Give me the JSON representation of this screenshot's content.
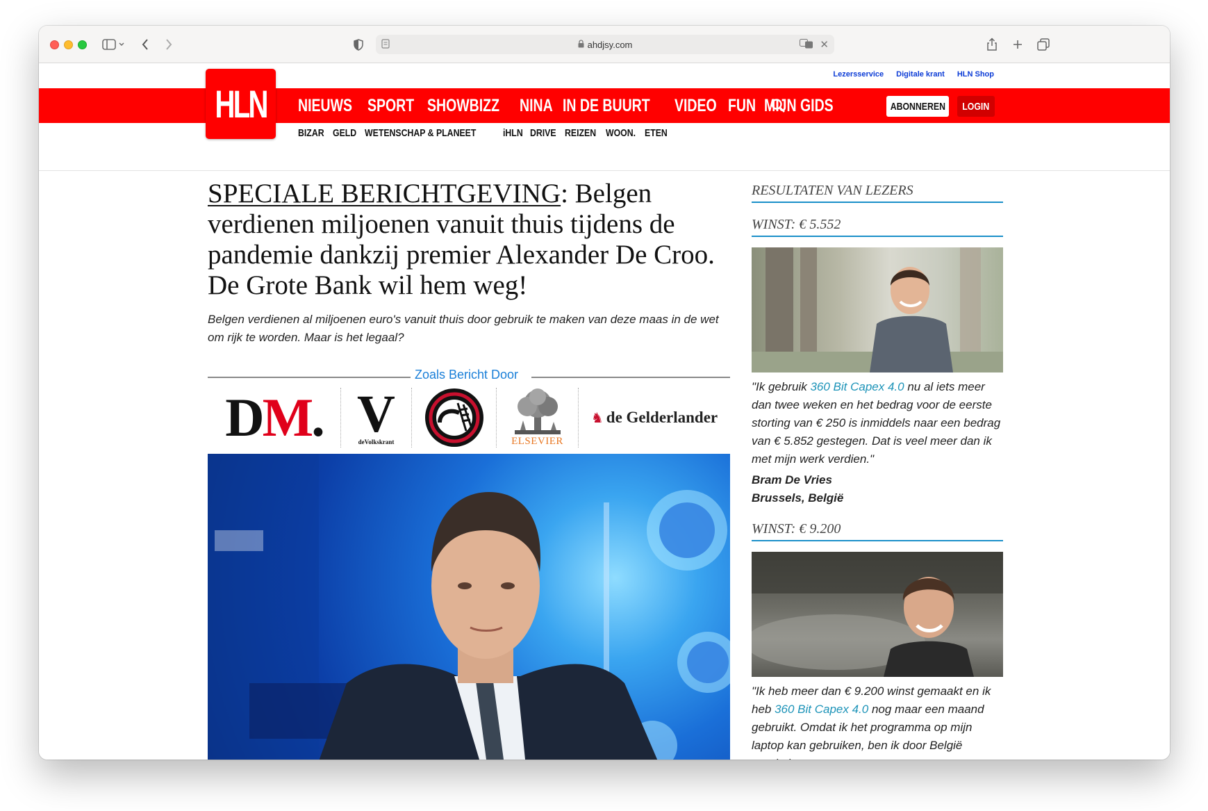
{
  "browser": {
    "url": "ahdjsy.com",
    "colors": {
      "close": "#ff5f57",
      "minimize": "#febc2e",
      "maximize": "#28c840"
    }
  },
  "site": {
    "logo": "HLN",
    "top_links": [
      "Lezersservice",
      "Digitale krant",
      "HLN Shop"
    ],
    "main_nav": [
      "NIEUWS",
      "SPORT",
      "SHOWBIZZ",
      "NINA",
      "IN DE BUURT",
      "VIDEO",
      "FUN",
      "MIJN GIDS"
    ],
    "sub_nav": [
      "BIZAR",
      "GELD",
      "WETENSCHAP & PLANEET",
      "iHLN",
      "DRIVE",
      "REIZEN",
      "WOON.",
      "ETEN"
    ],
    "subscribe_label": "ABONNEREN",
    "login_label": "LOGIN",
    "brand_color": "#ff0000"
  },
  "article": {
    "headline_prefix": "SPECIALE BERICHTGEVING",
    "headline_rest": ": Belgen verdienen miljoenen vanuit thuis tijdens de pandemie dankzij premier Alexander De Croo. De Grote Bank wil hem weg!",
    "lead": "Belgen verdienen al miljoenen euro's vanuit thuis door gebruik te maken van deze maas in de wet om rijk te worden. Maar is het legaal?",
    "as_seen_title": "Zoals Bericht Door",
    "press_logos": {
      "dm": "DM.",
      "volkskrant_letter": "V",
      "volkskrant_name": "deVolkskrant",
      "elsevier": "ELSEVIER",
      "gelderlander": "de Gelderlander"
    }
  },
  "sidebar": {
    "title": "RESULTATEN VAN LEZERS",
    "testimonials": [
      {
        "win": "WINST: € 5.552",
        "quote_before": "\"Ik gebruik ",
        "product": "360 Bit Capex 4.0",
        "quote_after": " nu al iets meer dan twee weken en het bedrag voor de eerste storting van € 250 is inmiddels naar een bedrag van € 5.852 gestegen. Dat is veel meer dan ik met mijn werk verdien.\"",
        "name": "Bram De Vries",
        "location": "Brussels, België"
      },
      {
        "win": "WINST: € 9.200",
        "quote_before": "\"Ik heb meer dan € 9.200 winst gemaakt en ik heb ",
        "product": "360 Bit Capex 4.0",
        "quote_after": " nog maar een maand gebruikt. Omdat ik het programma op mijn laptop kan gebruiken, ben ik door België gereisd"
      }
    ]
  }
}
